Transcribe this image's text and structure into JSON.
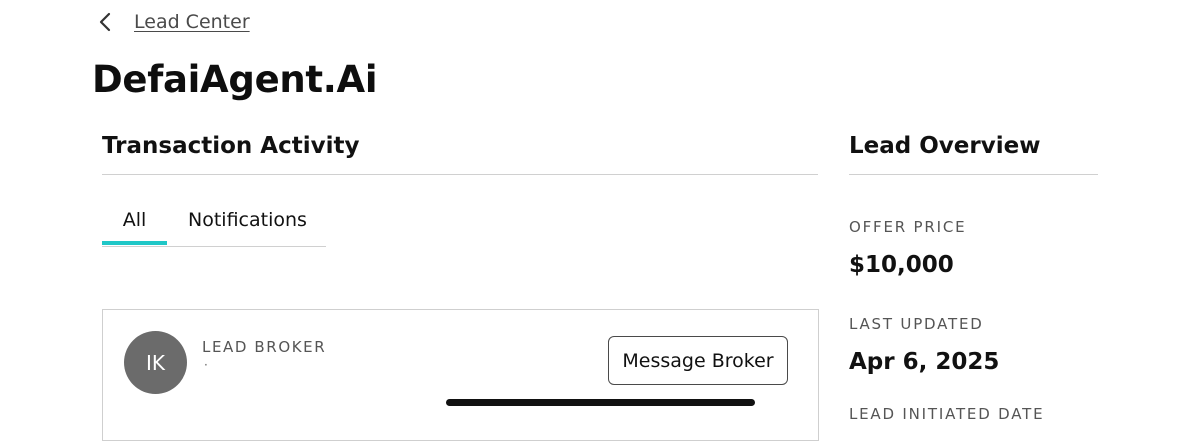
{
  "breadcrumb": {
    "back_label": "Lead Center",
    "icon": "chevron-left-icon"
  },
  "page": {
    "title": "DefaiAgent.Ai"
  },
  "transaction_activity": {
    "title": "Transaction Activity",
    "tabs": [
      {
        "label": "All",
        "active": true
      },
      {
        "label": "Notifications",
        "active": false
      }
    ],
    "broker_card": {
      "avatar_initials": "IK",
      "label": "LEAD BROKER",
      "name": "·",
      "message_button": "Message Broker"
    }
  },
  "lead_overview": {
    "title": "Lead Overview",
    "offer_price_label": "OFFER PRICE",
    "offer_price": "$10,000",
    "last_updated_label": "LAST UPDATED",
    "last_updated": "Apr 6, 2025",
    "initiated_label": "LEAD INITIATED DATE"
  },
  "colors": {
    "tab_indicator": "#1fc7c7",
    "avatar_bg": "#6b6b6b"
  }
}
